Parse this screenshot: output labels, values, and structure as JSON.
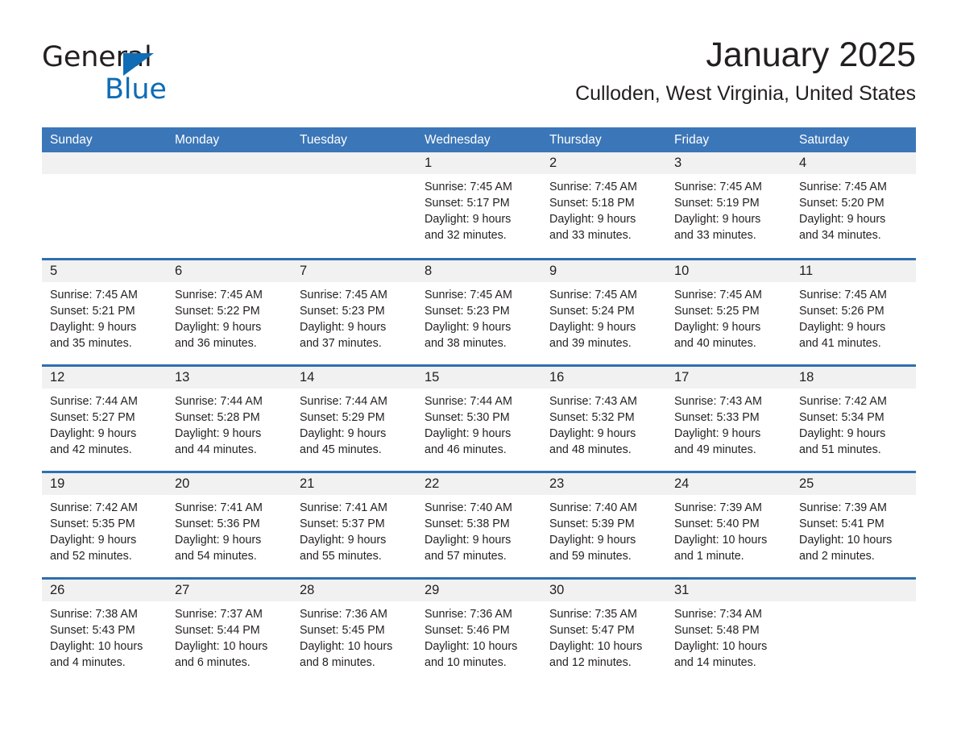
{
  "brand": {
    "name_part1": "General",
    "name_part2": "Blue",
    "triangle_color": "#0f6cb5",
    "accent_color": "#3b76b8"
  },
  "header": {
    "title": "January 2025",
    "subtitle": "Culloden, West Virginia, United States"
  },
  "calendar": {
    "weekday_headers": [
      "Sunday",
      "Monday",
      "Tuesday",
      "Wednesday",
      "Thursday",
      "Friday",
      "Saturday"
    ],
    "weeks": [
      [
        {
          "day": "",
          "lines": []
        },
        {
          "day": "",
          "lines": []
        },
        {
          "day": "",
          "lines": []
        },
        {
          "day": "1",
          "lines": [
            "Sunrise: 7:45 AM",
            "Sunset: 5:17 PM",
            "Daylight: 9 hours",
            "and 32 minutes."
          ]
        },
        {
          "day": "2",
          "lines": [
            "Sunrise: 7:45 AM",
            "Sunset: 5:18 PM",
            "Daylight: 9 hours",
            "and 33 minutes."
          ]
        },
        {
          "day": "3",
          "lines": [
            "Sunrise: 7:45 AM",
            "Sunset: 5:19 PM",
            "Daylight: 9 hours",
            "and 33 minutes."
          ]
        },
        {
          "day": "4",
          "lines": [
            "Sunrise: 7:45 AM",
            "Sunset: 5:20 PM",
            "Daylight: 9 hours",
            "and 34 minutes."
          ]
        }
      ],
      [
        {
          "day": "5",
          "lines": [
            "Sunrise: 7:45 AM",
            "Sunset: 5:21 PM",
            "Daylight: 9 hours",
            "and 35 minutes."
          ]
        },
        {
          "day": "6",
          "lines": [
            "Sunrise: 7:45 AM",
            "Sunset: 5:22 PM",
            "Daylight: 9 hours",
            "and 36 minutes."
          ]
        },
        {
          "day": "7",
          "lines": [
            "Sunrise: 7:45 AM",
            "Sunset: 5:23 PM",
            "Daylight: 9 hours",
            "and 37 minutes."
          ]
        },
        {
          "day": "8",
          "lines": [
            "Sunrise: 7:45 AM",
            "Sunset: 5:23 PM",
            "Daylight: 9 hours",
            "and 38 minutes."
          ]
        },
        {
          "day": "9",
          "lines": [
            "Sunrise: 7:45 AM",
            "Sunset: 5:24 PM",
            "Daylight: 9 hours",
            "and 39 minutes."
          ]
        },
        {
          "day": "10",
          "lines": [
            "Sunrise: 7:45 AM",
            "Sunset: 5:25 PM",
            "Daylight: 9 hours",
            "and 40 minutes."
          ]
        },
        {
          "day": "11",
          "lines": [
            "Sunrise: 7:45 AM",
            "Sunset: 5:26 PM",
            "Daylight: 9 hours",
            "and 41 minutes."
          ]
        }
      ],
      [
        {
          "day": "12",
          "lines": [
            "Sunrise: 7:44 AM",
            "Sunset: 5:27 PM",
            "Daylight: 9 hours",
            "and 42 minutes."
          ]
        },
        {
          "day": "13",
          "lines": [
            "Sunrise: 7:44 AM",
            "Sunset: 5:28 PM",
            "Daylight: 9 hours",
            "and 44 minutes."
          ]
        },
        {
          "day": "14",
          "lines": [
            "Sunrise: 7:44 AM",
            "Sunset: 5:29 PM",
            "Daylight: 9 hours",
            "and 45 minutes."
          ]
        },
        {
          "day": "15",
          "lines": [
            "Sunrise: 7:44 AM",
            "Sunset: 5:30 PM",
            "Daylight: 9 hours",
            "and 46 minutes."
          ]
        },
        {
          "day": "16",
          "lines": [
            "Sunrise: 7:43 AM",
            "Sunset: 5:32 PM",
            "Daylight: 9 hours",
            "and 48 minutes."
          ]
        },
        {
          "day": "17",
          "lines": [
            "Sunrise: 7:43 AM",
            "Sunset: 5:33 PM",
            "Daylight: 9 hours",
            "and 49 minutes."
          ]
        },
        {
          "day": "18",
          "lines": [
            "Sunrise: 7:42 AM",
            "Sunset: 5:34 PM",
            "Daylight: 9 hours",
            "and 51 minutes."
          ]
        }
      ],
      [
        {
          "day": "19",
          "lines": [
            "Sunrise: 7:42 AM",
            "Sunset: 5:35 PM",
            "Daylight: 9 hours",
            "and 52 minutes."
          ]
        },
        {
          "day": "20",
          "lines": [
            "Sunrise: 7:41 AM",
            "Sunset: 5:36 PM",
            "Daylight: 9 hours",
            "and 54 minutes."
          ]
        },
        {
          "day": "21",
          "lines": [
            "Sunrise: 7:41 AM",
            "Sunset: 5:37 PM",
            "Daylight: 9 hours",
            "and 55 minutes."
          ]
        },
        {
          "day": "22",
          "lines": [
            "Sunrise: 7:40 AM",
            "Sunset: 5:38 PM",
            "Daylight: 9 hours",
            "and 57 minutes."
          ]
        },
        {
          "day": "23",
          "lines": [
            "Sunrise: 7:40 AM",
            "Sunset: 5:39 PM",
            "Daylight: 9 hours",
            "and 59 minutes."
          ]
        },
        {
          "day": "24",
          "lines": [
            "Sunrise: 7:39 AM",
            "Sunset: 5:40 PM",
            "Daylight: 10 hours",
            "and 1 minute."
          ]
        },
        {
          "day": "25",
          "lines": [
            "Sunrise: 7:39 AM",
            "Sunset: 5:41 PM",
            "Daylight: 10 hours",
            "and 2 minutes."
          ]
        }
      ],
      [
        {
          "day": "26",
          "lines": [
            "Sunrise: 7:38 AM",
            "Sunset: 5:43 PM",
            "Daylight: 10 hours",
            "and 4 minutes."
          ]
        },
        {
          "day": "27",
          "lines": [
            "Sunrise: 7:37 AM",
            "Sunset: 5:44 PM",
            "Daylight: 10 hours",
            "and 6 minutes."
          ]
        },
        {
          "day": "28",
          "lines": [
            "Sunrise: 7:36 AM",
            "Sunset: 5:45 PM",
            "Daylight: 10 hours",
            "and 8 minutes."
          ]
        },
        {
          "day": "29",
          "lines": [
            "Sunrise: 7:36 AM",
            "Sunset: 5:46 PM",
            "Daylight: 10 hours",
            "and 10 minutes."
          ]
        },
        {
          "day": "30",
          "lines": [
            "Sunrise: 7:35 AM",
            "Sunset: 5:47 PM",
            "Daylight: 10 hours",
            "and 12 minutes."
          ]
        },
        {
          "day": "31",
          "lines": [
            "Sunrise: 7:34 AM",
            "Sunset: 5:48 PM",
            "Daylight: 10 hours",
            "and 14 minutes."
          ]
        },
        {
          "day": "",
          "lines": []
        }
      ]
    ]
  }
}
